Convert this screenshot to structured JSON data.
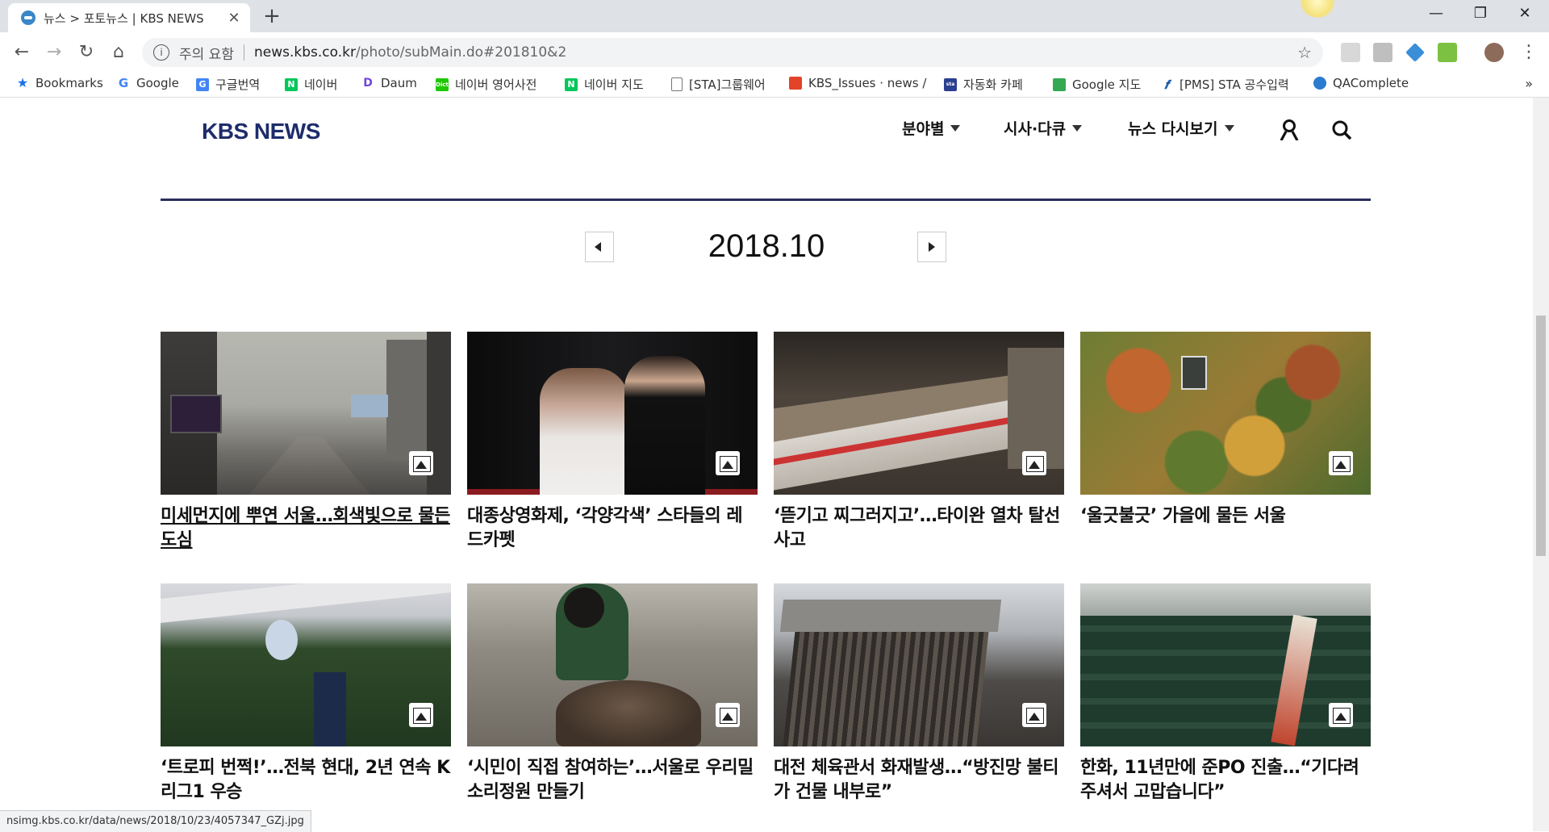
{
  "browser": {
    "tab_title": "뉴스 > 포토뉴스 | KBS NEWS",
    "new_tab": "+",
    "window_controls": [
      "—",
      "❐",
      "✕"
    ],
    "address": {
      "security_label": "주의 요함",
      "host": "news.kbs.co.kr",
      "path": "/photo/subMain.do#201810&2"
    },
    "bookmarks": [
      {
        "label": "Bookmarks",
        "icon": "star-icon"
      },
      {
        "label": "Google",
        "icon": "google-icon"
      },
      {
        "label": "구글번역",
        "icon": "translate-icon"
      },
      {
        "label": "네이버",
        "icon": "naver-icon"
      },
      {
        "label": "Daum",
        "icon": "daum-icon"
      },
      {
        "label": "네이버 영어사전",
        "icon": "dict-icon"
      },
      {
        "label": "네이버 지도",
        "icon": "naver-icon"
      },
      {
        "label": "[STA]그룹웨어",
        "icon": "page-icon"
      },
      {
        "label": "KBS_Issues · news /",
        "icon": "gitlab-icon"
      },
      {
        "label": "자동화 카페",
        "icon": "cafe-icon"
      },
      {
        "label": "Google 지도",
        "icon": "maps-icon"
      },
      {
        "label": "[PMS] STA 공수입력",
        "icon": "pms-icon"
      },
      {
        "label": "QAComplete",
        "icon": "qa-icon"
      }
    ],
    "bookmarks_more": "»",
    "status_url": "nsimg.kbs.co.kr/data/news/2018/10/23/4057347_GZj.jpg"
  },
  "site": {
    "logo": "KBS NEWS",
    "menu": [
      "분야별",
      "시사·다큐",
      "뉴스 다시보기"
    ]
  },
  "month_nav": {
    "label": "2018.10"
  },
  "cards": [
    {
      "caption": "미세먼지에 뿌연 서울…회색빛으로 물든 도심"
    },
    {
      "caption": "대종상영화제, ‘각양각색’ 스타들의 레드카펫"
    },
    {
      "caption": "‘뜯기고 찌그러지고’…타이완 열차 탈선 사고"
    },
    {
      "caption": "‘울긋불긋’ 가을에 물든 서울"
    },
    {
      "caption": "‘트로피 번쩍!’…전북 현대, 2년 연속 K리그1 우승"
    },
    {
      "caption": "‘시민이 직접 참여하는’…서울로 우리밀 소리정원 만들기"
    },
    {
      "caption": "대전 체육관서 화재발생…“방진망 불티가 건물 내부로”"
    },
    {
      "caption": "한화, 11년만에 준PO 진출…“기다려주셔서 고맙습니다”"
    }
  ],
  "colors": {
    "logo": "#1d2c6b",
    "divider": "#2a2e5c"
  }
}
